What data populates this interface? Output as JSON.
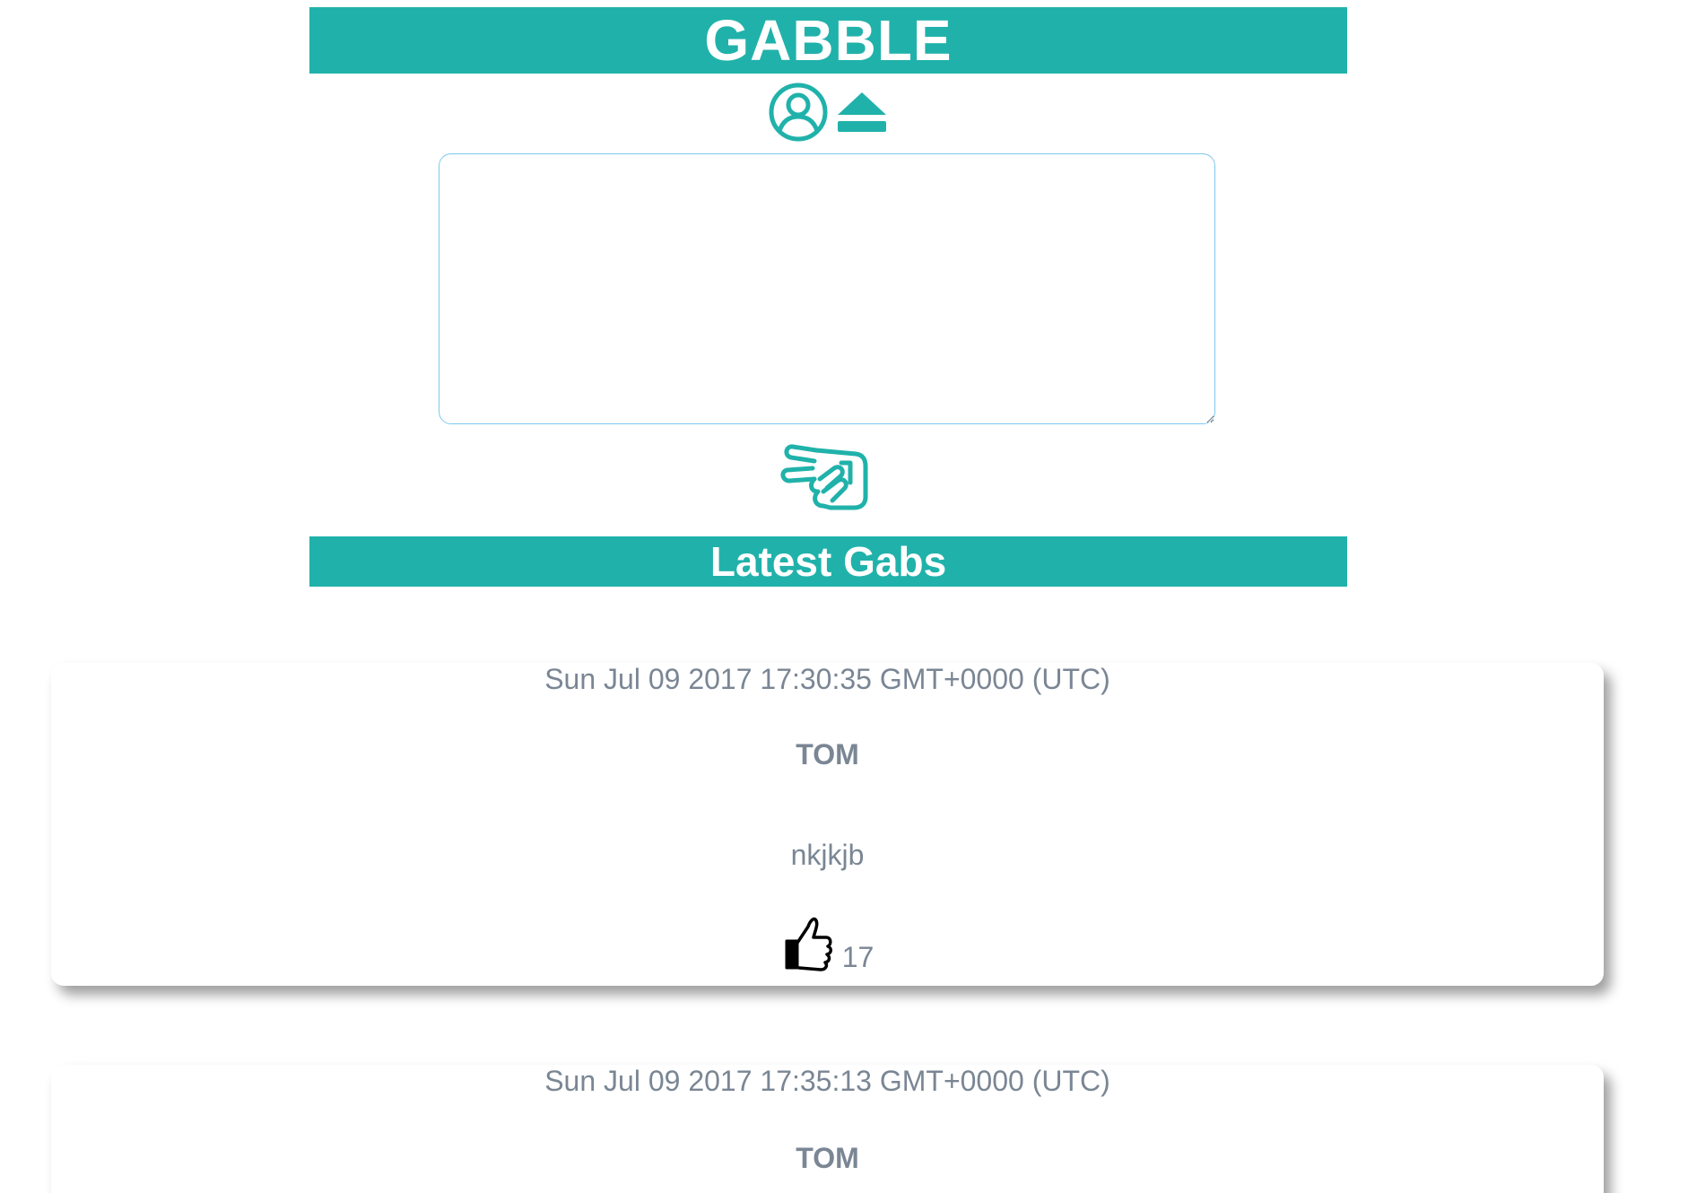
{
  "app": {
    "title": "GABBLE",
    "accent_color": "#20b2aa"
  },
  "header": {
    "profile_icon": "user-circle-icon",
    "logout_icon": "eject-icon"
  },
  "compose": {
    "value": "",
    "placeholder": "",
    "post_icon": "peace-hand-icon"
  },
  "feed": {
    "heading": "Latest Gabs",
    "gabs": [
      {
        "date": "Sun Jul 09 2017 17:30:35 GMT+0000 (UTC)",
        "user": "TOM",
        "text": "nkjkjb",
        "like_icon": "thumbs-up-icon",
        "likes": "17"
      },
      {
        "date": "Sun Jul 09 2017 17:35:13 GMT+0000 (UTC)",
        "user": "TOM"
      }
    ]
  }
}
